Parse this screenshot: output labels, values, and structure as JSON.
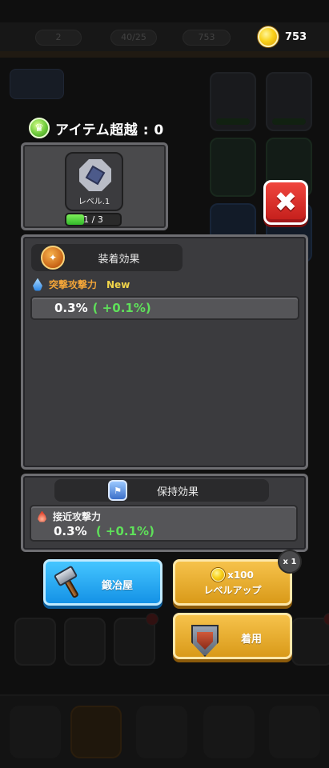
{
  "currency": {
    "icon": "gold-coin-icon",
    "amount": "753"
  },
  "background": {
    "topbar": {
      "level": "2",
      "keys": "40/25",
      "coins": "753"
    }
  },
  "transcendence": {
    "label": "アイテム超越 : 0"
  },
  "item": {
    "icon": "armor-plate-icon",
    "level_label": "レベル.1",
    "progress_text": "1 / 3",
    "progress_fraction": 0.333
  },
  "equip_effect": {
    "header": "装着効果",
    "stat_name": "突撃攻撃力",
    "new_label": "New",
    "current": "0.3%",
    "increase": "( +0.1%)"
  },
  "retain_effect": {
    "header": "保持効果",
    "stat_name": "接近攻撃力",
    "current": "0.3%",
    "increase": "( +0.1%)"
  },
  "buttons": {
    "smith": "鍛冶屋",
    "levelup_cost": "x100",
    "levelup": "レベルアップ",
    "multiplier": "x 1",
    "equip": "着用"
  },
  "colors": {
    "accent_green": "#5fe05a",
    "accent_orange": "#f0a338",
    "close_red": "#e03a33",
    "button_blue": "#1492e6",
    "button_gold": "#d99a19"
  }
}
